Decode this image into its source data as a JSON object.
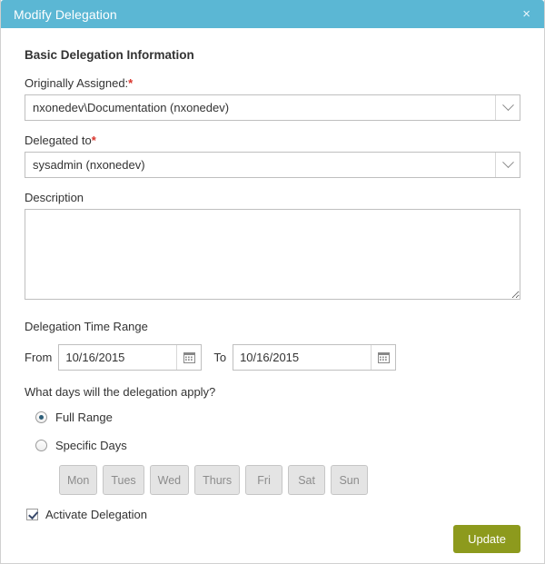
{
  "window": {
    "title": "Modify Delegation",
    "close_icon": "close-icon",
    "close_glyph": "×",
    "header_color": "#5bb7d4"
  },
  "form": {
    "section_title": "Basic Delegation Information",
    "originally_assigned": {
      "label": "Originally Assigned:",
      "required_marker": "*",
      "value": "nxonedev\\Documentation (nxonedev)",
      "arrow_icon": "chevron-down-icon"
    },
    "delegated_to": {
      "label": "Delegated to",
      "required_marker": "*",
      "value": "sysadmin (nxonedev)",
      "arrow_icon": "chevron-down-icon"
    },
    "description": {
      "label": "Description",
      "value": "",
      "placeholder": ""
    },
    "time_range": {
      "title": "Delegation Time Range",
      "from_label": "From",
      "from_value": "10/16/2015",
      "to_label": "To",
      "to_value": "10/16/2015",
      "calendar_icon": "calendar-icon"
    },
    "days_question": "What days will the delegation apply?",
    "range_options": [
      {
        "label": "Full Range",
        "selected": true
      },
      {
        "label": "Specific Days",
        "selected": false
      }
    ],
    "day_buttons": [
      {
        "label": "Mon",
        "enabled": false
      },
      {
        "label": "Tues",
        "enabled": false
      },
      {
        "label": "Wed",
        "enabled": false
      },
      {
        "label": "Thurs",
        "enabled": false
      },
      {
        "label": "Fri",
        "enabled": false
      },
      {
        "label": "Sat",
        "enabled": false
      },
      {
        "label": "Sun",
        "enabled": false
      }
    ],
    "activate": {
      "label": "Activate Delegation",
      "checked": true
    }
  },
  "footer": {
    "update_label": "Update",
    "update_color": "#8d9a1d"
  }
}
